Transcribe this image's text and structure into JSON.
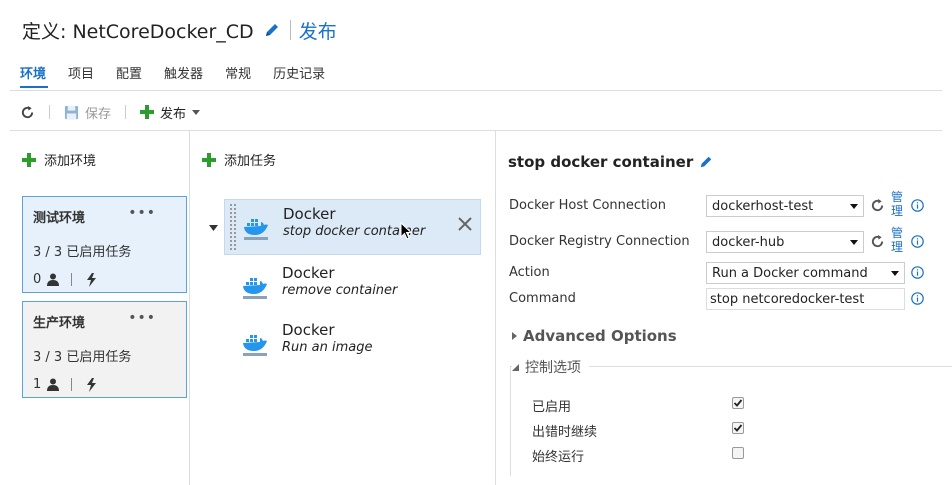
{
  "header": {
    "title": "定义: NetCoreDocker_CD",
    "release_link": "发布"
  },
  "tabs": [
    "环境",
    "项目",
    "配置",
    "触发器",
    "常规",
    "历史记录"
  ],
  "toolbar": {
    "save_label": "保存",
    "release_label": "发布"
  },
  "environments": {
    "add_label": "添加环境",
    "items": [
      {
        "name": "测试环境",
        "tasks": "3 / 3 已启用任务",
        "approvers": "0"
      },
      {
        "name": "生产环境",
        "tasks": "3 / 3 已启用任务",
        "approvers": "1"
      }
    ]
  },
  "tasks": {
    "add_label": "添加任务",
    "items": [
      {
        "name": "Docker",
        "desc": "stop docker container"
      },
      {
        "name": "Docker",
        "desc": "remove container"
      },
      {
        "name": "Docker",
        "desc": "Run an image"
      }
    ]
  },
  "detail": {
    "title": "stop docker container",
    "fields": {
      "host_label": "Docker Host Connection",
      "host_value": "dockerhost-test",
      "registry_label": "Docker Registry Connection",
      "registry_value": "docker-hub",
      "action_label": "Action",
      "action_value": "Run a Docker command",
      "command_label": "Command",
      "command_value": "stop netcoredocker-test",
      "manage_label": "管理"
    },
    "advanced_label": "Advanced Options",
    "control_label": "控制选项",
    "options": [
      {
        "label": "已启用",
        "checked": true
      },
      {
        "label": "出错时继续",
        "checked": true
      },
      {
        "label": "始终运行",
        "checked": false
      }
    ]
  },
  "colors": {
    "accent": "#1a72c6",
    "green": "#2a9d2a",
    "selected_env_bg": "#e6f1fb",
    "selected_task_bg": "#dce9f7"
  }
}
